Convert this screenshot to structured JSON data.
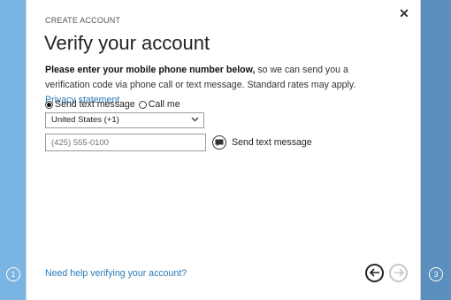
{
  "left_step": {
    "number": "1"
  },
  "right_step": {
    "number": "3"
  },
  "dialog": {
    "section_label": "CREATE ACCOUNT",
    "close_symbol": "✕",
    "title": "Verify your account",
    "description_bold": "Please enter your mobile phone number below,",
    "description_text": " so we can send you a verification code via phone call or text message. Standard rates may apply. ",
    "privacy_link": "Privacy statement",
    "radio": {
      "option1": "Send text message",
      "option2": "Call me",
      "selected": "option1"
    },
    "country_select": {
      "value": "United States (+1)"
    },
    "phone_input": {
      "placeholder": "(425) 555-0100",
      "value": ""
    },
    "send_button_label": "Send text message",
    "help_link": "Need help verifying your account?",
    "nav": {
      "back_icon": "arrow-left-icon",
      "next_icon": "arrow-right-icon"
    }
  },
  "colors": {
    "left_panel": "#7ab4e2",
    "right_panel": "#5b8fbd",
    "link": "#2a7ab8"
  }
}
